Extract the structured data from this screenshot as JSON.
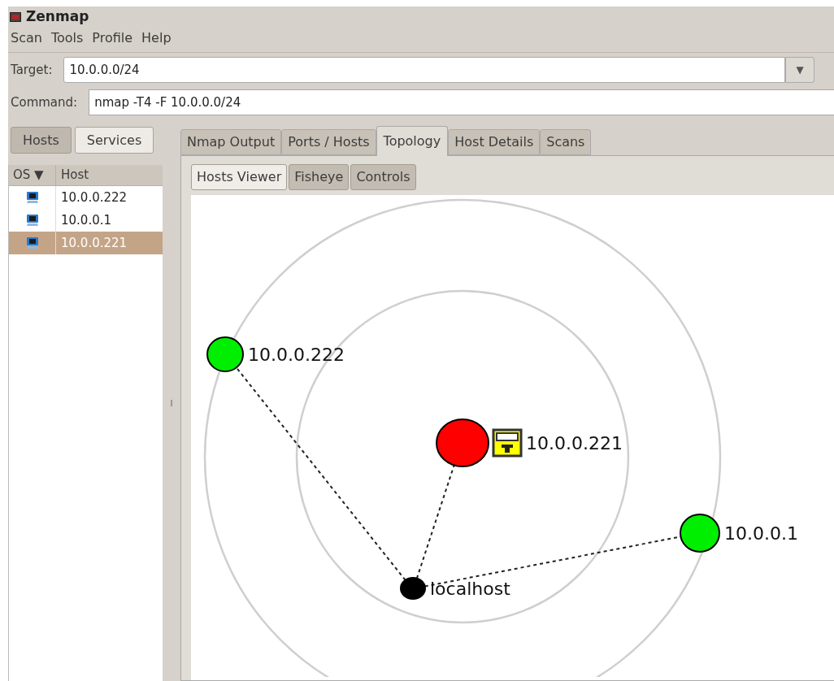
{
  "window": {
    "title": "Zenmap"
  },
  "menu": [
    "Scan",
    "Tools",
    "Profile",
    "Help"
  ],
  "target": {
    "label": "Target:",
    "value": "10.0.0.0/24",
    "dropdown": "▼"
  },
  "command": {
    "label": "Command:",
    "value": "nmap -T4 -F 10.0.0.0/24"
  },
  "view_toggle": [
    {
      "label": "Hosts",
      "selected": true
    },
    {
      "label": "Services",
      "selected": false
    }
  ],
  "host_table": {
    "columns": [
      "OS ▼",
      "Host"
    ],
    "rows": [
      {
        "host": "10.0.0.222",
        "selected": false
      },
      {
        "host": "10.0.0.1",
        "selected": false
      },
      {
        "host": "10.0.0.221",
        "selected": true
      }
    ]
  },
  "tabs": [
    {
      "label": "Nmap Output",
      "selected": false
    },
    {
      "label": "Ports / Hosts",
      "selected": false
    },
    {
      "label": "Topology",
      "selected": true
    },
    {
      "label": "Host Details",
      "selected": false
    },
    {
      "label": "Scans",
      "selected": false
    }
  ],
  "topology_buttons": [
    {
      "label": "Hosts Viewer",
      "pressed": false
    },
    {
      "label": "Fisheye",
      "pressed": true
    },
    {
      "label": "Controls",
      "pressed": true
    }
  ],
  "topology": {
    "nodes": [
      {
        "label": "10.0.0.222",
        "color": "#00ee00",
        "locked": false
      },
      {
        "label": "10.0.0.221",
        "color": "#ff0000",
        "locked": true
      },
      {
        "label": "10.0.0.1",
        "color": "#00ee00",
        "locked": false
      },
      {
        "label": "localhost",
        "color": "#000000",
        "locked": false
      }
    ]
  }
}
